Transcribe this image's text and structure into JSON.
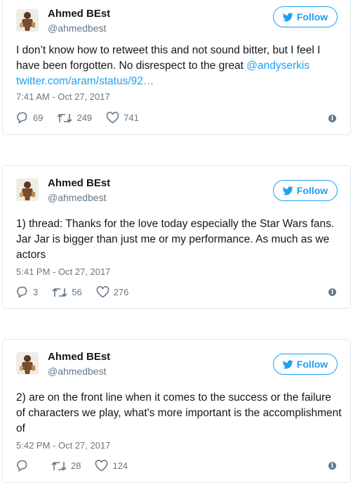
{
  "colors": {
    "accent": "#1da1f2",
    "secondary_text": "#657786",
    "border": "#e1e8ed"
  },
  "tweets": [
    {
      "author_name": "Ahmed BEst",
      "author_handle": "@ahmedbest",
      "follow_label": "Follow",
      "text_before": "I don’t know how to retweet this and not sound bitter, but I feel I have been forgotten. No disrespect to the great ",
      "mention": "@andyserkis",
      "link": "twitter.com/aram/status/92…",
      "timestamp": "7:41 AM - Oct 27, 2017",
      "replies": "69",
      "retweets": "249",
      "likes": "741"
    },
    {
      "author_name": "Ahmed BEst",
      "author_handle": "@ahmedbest",
      "follow_label": "Follow",
      "text": "1) thread: Thanks for the love today especially the Star Wars fans. Jar Jar is bigger than just me or my performance. As much as we actors",
      "timestamp": "5:41 PM - Oct 27, 2017",
      "replies": "3",
      "retweets": "56",
      "likes": "276"
    },
    {
      "author_name": "Ahmed BEst",
      "author_handle": "@ahmedbest",
      "follow_label": "Follow",
      "text": "2) are on the front line when it comes to the success or the failure of characters we play, what's more important is the accomplishment of",
      "timestamp": "5:42 PM - Oct 27, 2017",
      "replies": "",
      "retweets": "28",
      "likes": "124"
    }
  ]
}
